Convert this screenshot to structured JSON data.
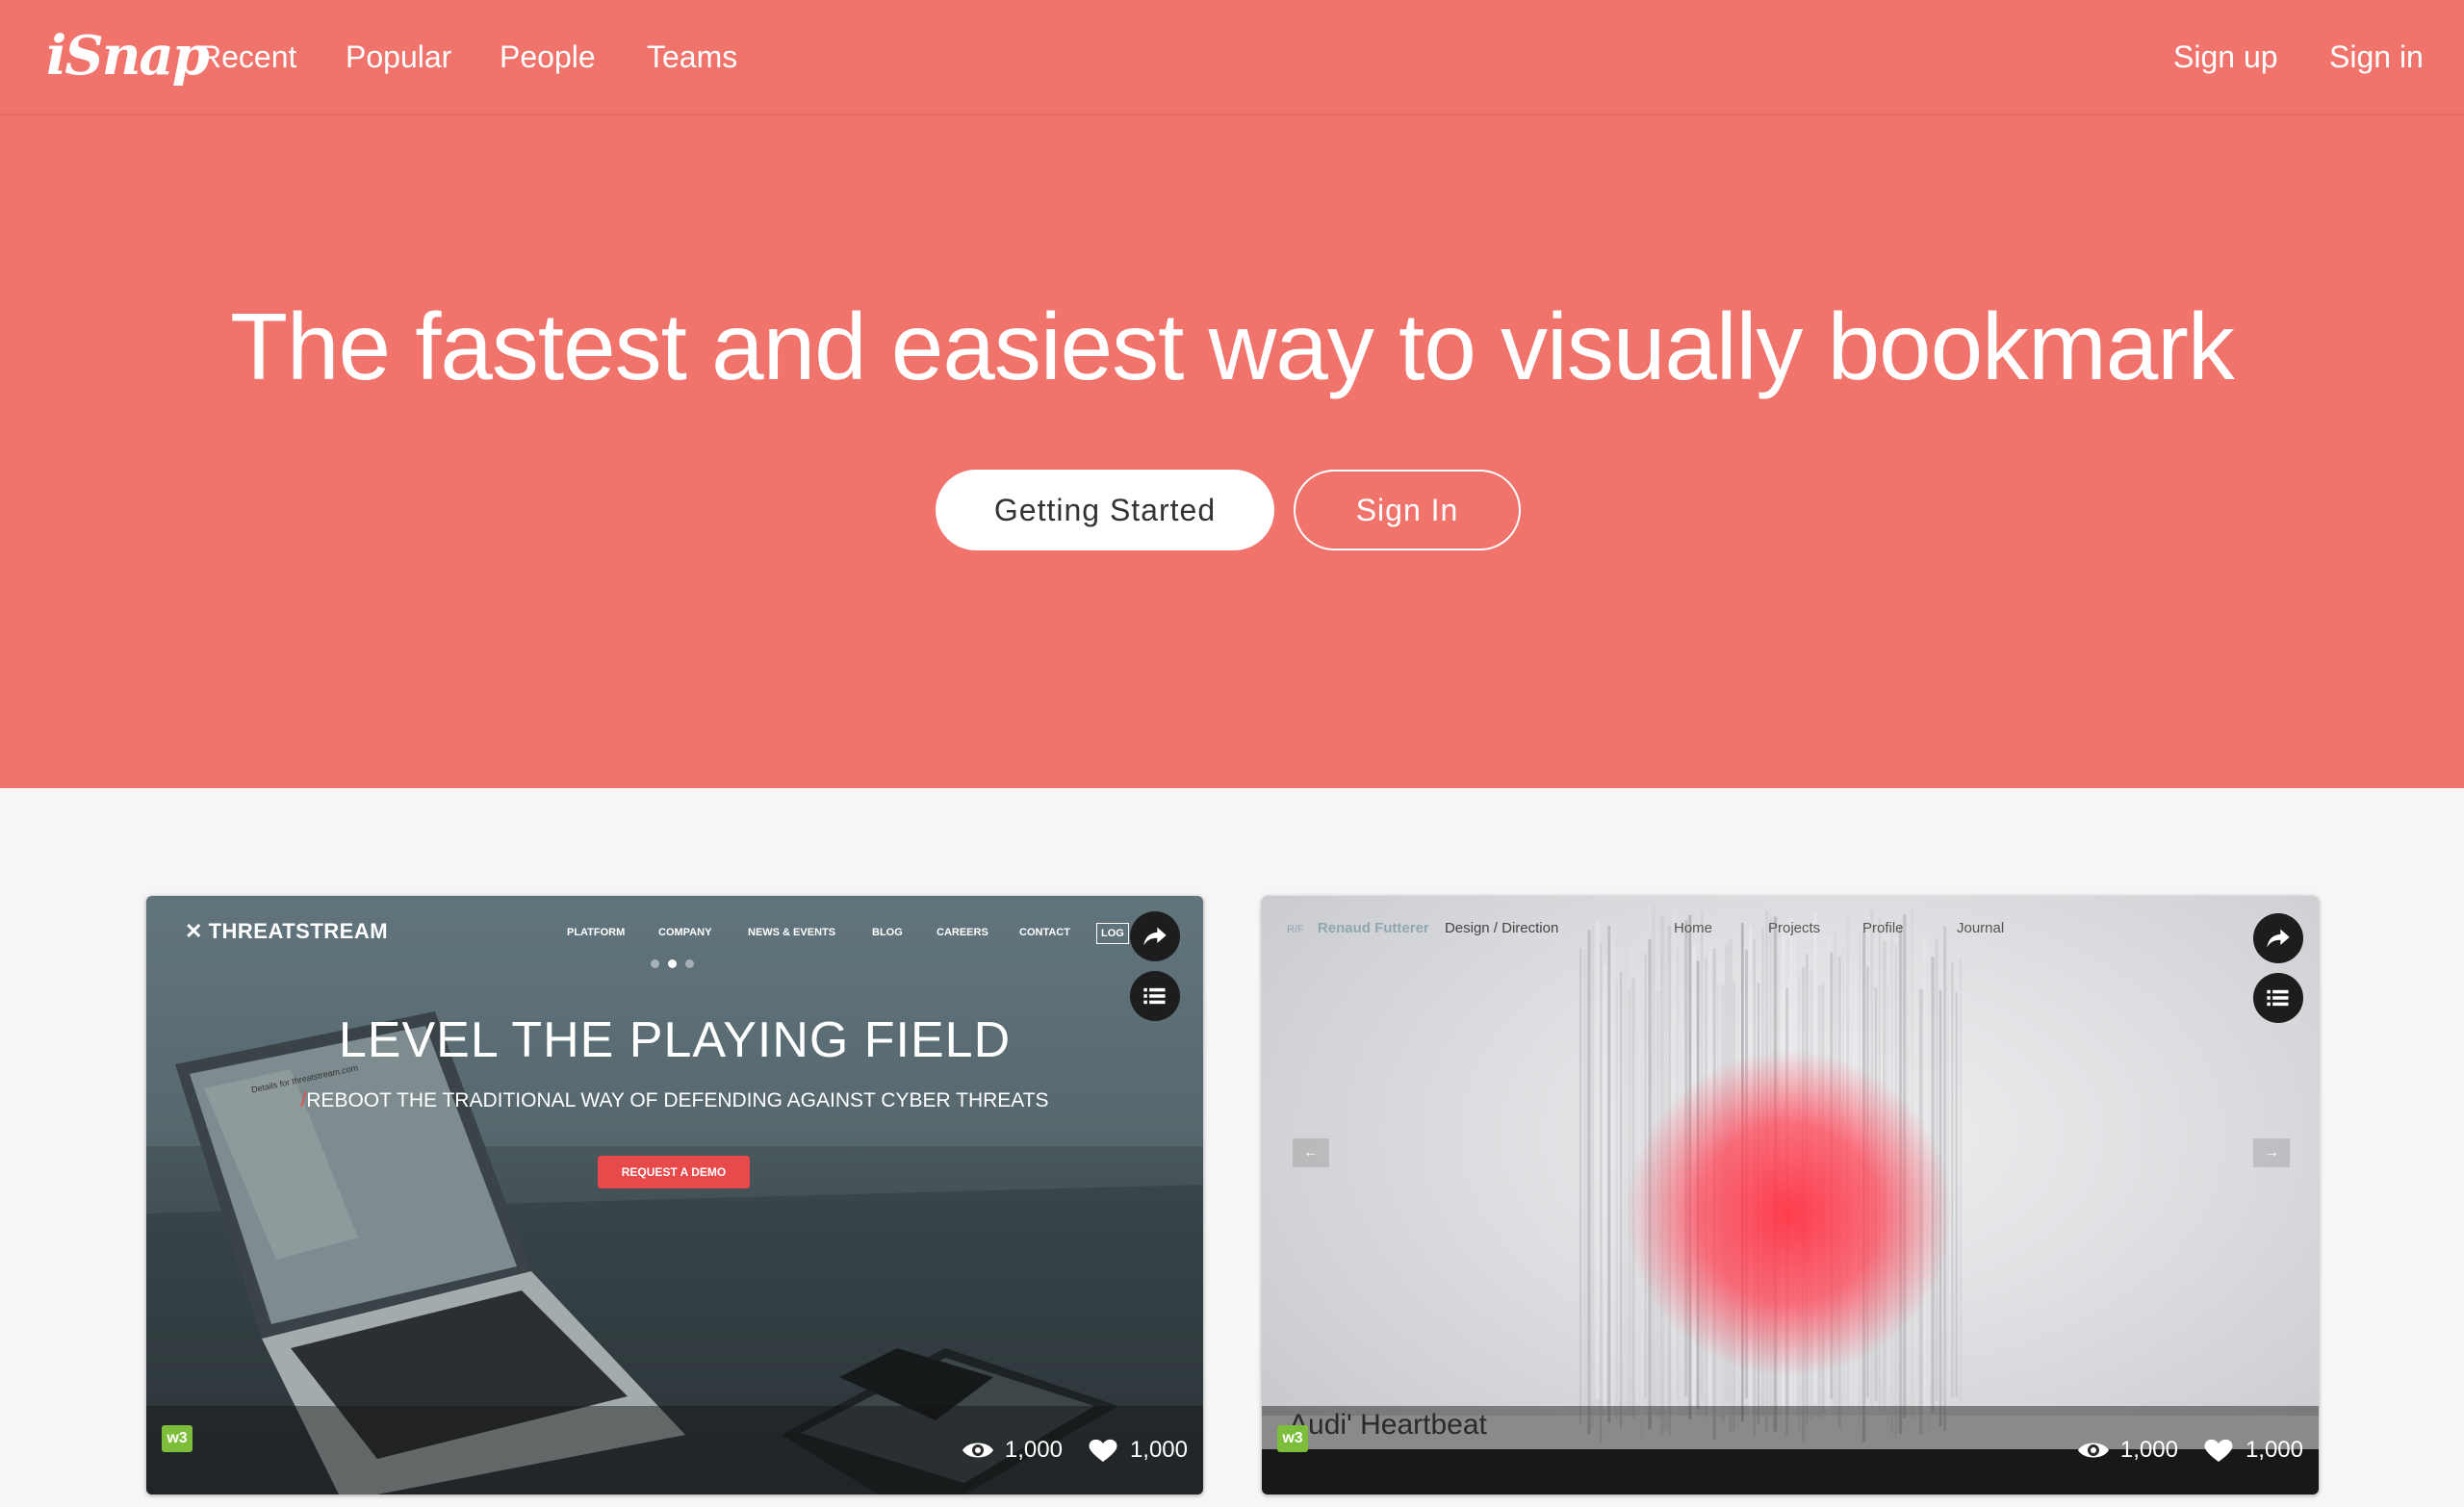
{
  "nav": {
    "logo": "iSnap",
    "links": [
      "Recent",
      "Popular",
      "People",
      "Teams"
    ],
    "signup": "Sign up",
    "signin": "Sign in"
  },
  "hero": {
    "title": "The fastest and easiest way to visually bookmark",
    "primary_button": "Getting Started",
    "secondary_button": "Sign In"
  },
  "cards": [
    {
      "site_logo": "THREATSTREAM",
      "site_nav": [
        "PLATFORM",
        "COMPANY",
        "NEWS & EVENTS",
        "BLOG",
        "CAREERS",
        "CONTACT",
        "LOG"
      ],
      "headline": "LEVEL THE PLAYING FIELD",
      "subheadline": "REBOOT THE TRADITIONAL WAY OF DEFENDING AGAINST CYBER THREATS",
      "cta": "REQUEST A DEMO",
      "laptop_screen_text": "Details for threatstream.com",
      "badge": "w3",
      "views": "1,000",
      "likes": "1,000"
    },
    {
      "site_brand_mark": "R/F",
      "site_brand": "Renaud Futterer",
      "site_tagline": "Design / Direction",
      "site_nav": [
        "Home",
        "Projects",
        "Profile",
        "Journal"
      ],
      "arrow_left": "←",
      "arrow_right": "→",
      "caption": "Audi' Heartbeat",
      "badge": "w3",
      "views": "1,000",
      "likes": "1,000"
    }
  ],
  "colors": {
    "brand": "#f0736c",
    "cta": "#e8494a",
    "badge": "#7cbd3a"
  },
  "icons": [
    "share-icon",
    "list-icon",
    "eye-icon",
    "heart-icon"
  ]
}
